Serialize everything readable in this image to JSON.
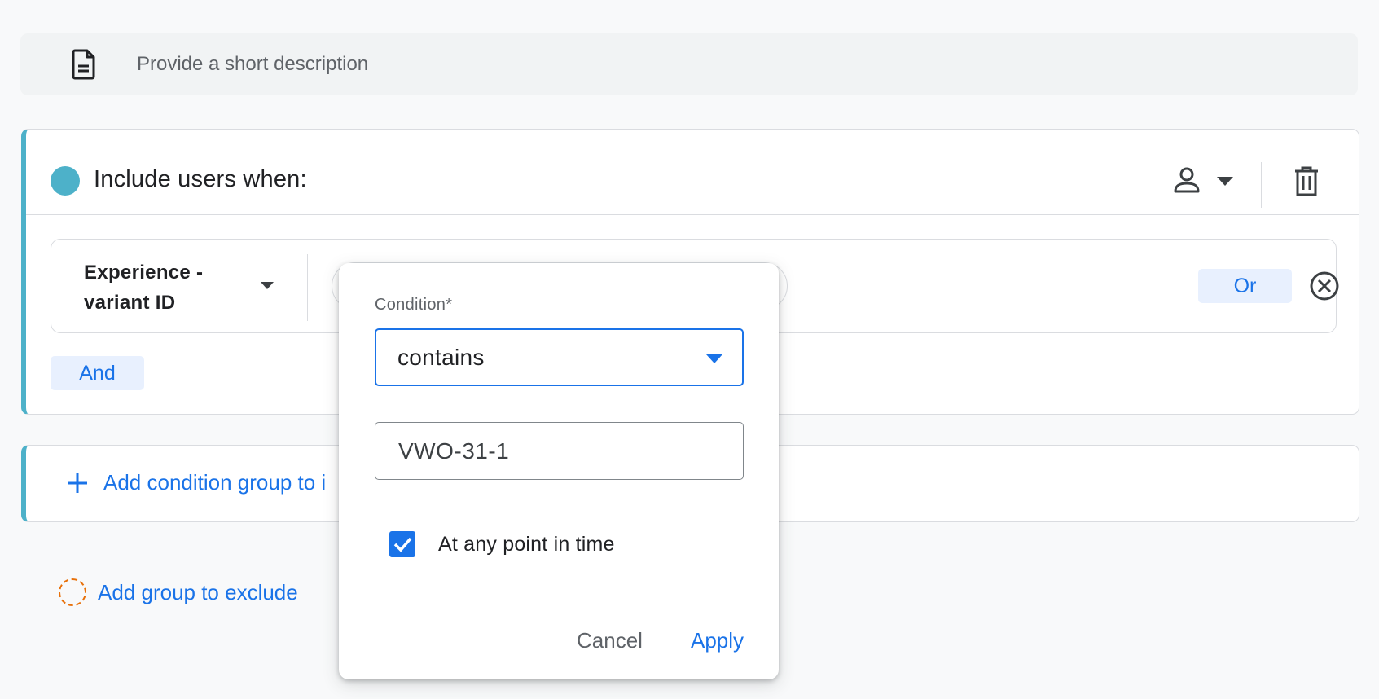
{
  "description": {
    "placeholder": "Provide a short description",
    "icon": "document-icon"
  },
  "include_group": {
    "title": "Include users when:",
    "accent_color": "#4db1c9",
    "scope_icon": "person-icon",
    "delete_icon": "trash-icon",
    "condition": {
      "dimension_label": "Experience - variant ID",
      "or_label": "Or",
      "remove_icon": "close-circle-icon"
    },
    "and_label": "And"
  },
  "add_condition_group": {
    "label": "Add condition group to i",
    "icon": "plus-icon"
  },
  "exclude": {
    "label": "Add group to exclude",
    "icon_color": "#e8710a"
  },
  "popup": {
    "condition_label": "Condition*",
    "condition_value": "contains",
    "value_input": "VWO-31-1",
    "checkbox_label": "At any point in time",
    "checkbox_checked": true,
    "cancel_label": "Cancel",
    "apply_label": "Apply"
  },
  "colors": {
    "primary": "#1a73e8",
    "chip_bg": "#e8f0fe"
  }
}
